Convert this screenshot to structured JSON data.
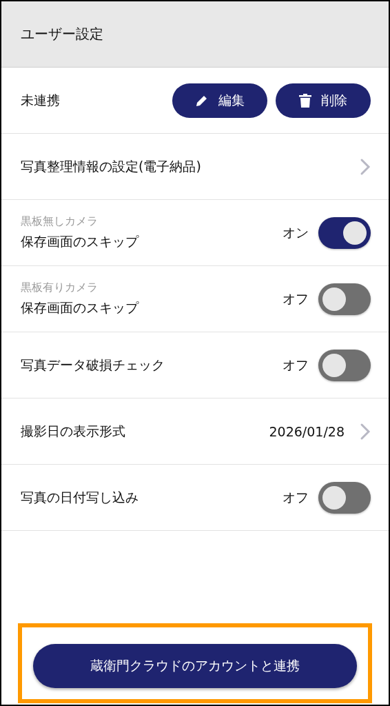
{
  "header": {
    "title": "ユーザー設定"
  },
  "rows": [
    {
      "kind": "buttons",
      "label": "未連携",
      "buttons": [
        {
          "kind": "edit",
          "label": "編集"
        },
        {
          "kind": "delete",
          "label": "削除"
        }
      ]
    },
    {
      "kind": "link",
      "label": "写真整理情報の設定(電子納品)"
    },
    {
      "kind": "toggle",
      "sublabel": "黒板無しカメラ",
      "label": "保存画面のスキップ",
      "state_text": "オン",
      "on": true
    },
    {
      "kind": "toggle",
      "sublabel": "黒板有りカメラ",
      "label": "保存画面のスキップ",
      "state_text": "オフ",
      "on": false
    },
    {
      "kind": "toggle",
      "label": "写真データ破損チェック",
      "state_text": "オフ",
      "on": false
    },
    {
      "kind": "link",
      "label": "撮影日の表示形式",
      "value": "2026/01/28"
    },
    {
      "kind": "toggle",
      "label": "写真の日付写し込み",
      "state_text": "オフ",
      "on": false
    }
  ],
  "footer": {
    "button": "蔵衛門クラウドのアカウントと連携",
    "highlighted": true
  }
}
